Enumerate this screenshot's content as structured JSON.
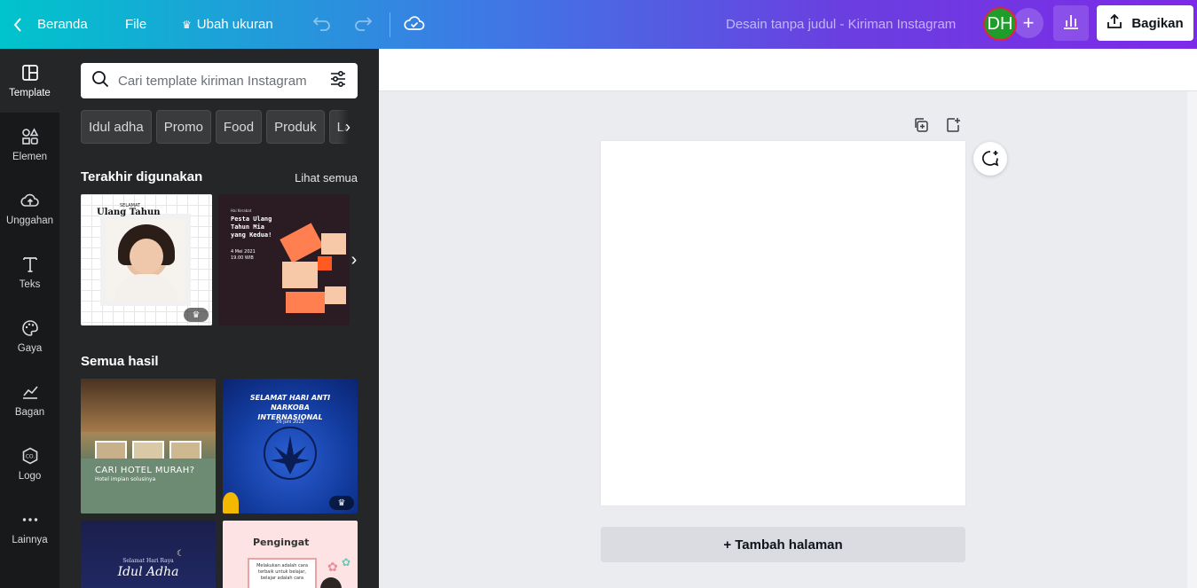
{
  "topbar": {
    "home_label": "Beranda",
    "file_label": "File",
    "resize_label": "Ubah ukuran",
    "doc_title": "Desain tanpa judul - Kiriman Instagram",
    "avatar_initials": "DH",
    "share_label": "Bagikan",
    "gradient_start": "#00c4cc",
    "gradient_end": "#7d2ae8"
  },
  "rail": {
    "items": [
      {
        "label": "Template",
        "icon": "template-icon"
      },
      {
        "label": "Elemen",
        "icon": "elements-icon"
      },
      {
        "label": "Unggahan",
        "icon": "upload-icon"
      },
      {
        "label": "Teks",
        "icon": "text-icon"
      },
      {
        "label": "Gaya",
        "icon": "palette-icon"
      },
      {
        "label": "Bagan",
        "icon": "chart-icon"
      },
      {
        "label": "Logo",
        "icon": "logo-icon"
      },
      {
        "label": "Lainnya",
        "icon": "more-icon"
      }
    ]
  },
  "panel": {
    "search_placeholder": "Cari template kiriman Instagram",
    "chips": [
      "Idul adha",
      "Promo",
      "Food",
      "Produk",
      "La"
    ],
    "recent_title": "Terakhir digunakan",
    "see_all": "Lihat semua",
    "all_results_title": "Semua hasil",
    "thumbs": {
      "birthday": {
        "line1": "SELAMAT",
        "line2": "Ulang Tahun"
      },
      "party": {
        "small": "Hai Kerabat",
        "title": "Pesta Ulang Tahun Mia yang Kedua!",
        "date": "4 Mei 2021",
        "time": "19.00 WIB"
      },
      "hotel": {
        "title": "CARI HOTEL MURAH?",
        "subtitle": "Hotel impian solusinya"
      },
      "narkoba": {
        "title": "SELAMAT HARI ANTI NARKOBA INTERNASIONAL",
        "date": "26 juni 2022"
      },
      "iduladha": {
        "small": "Selamat Hari Raya",
        "title": "Idul Adha"
      },
      "pengingat": {
        "title": "Pengingat",
        "body": "Melakukan adalah cara terbaik untuk belajar, belajar adalah cara"
      }
    }
  },
  "canvas": {
    "add_page_label": "+ Tambah halaman"
  }
}
